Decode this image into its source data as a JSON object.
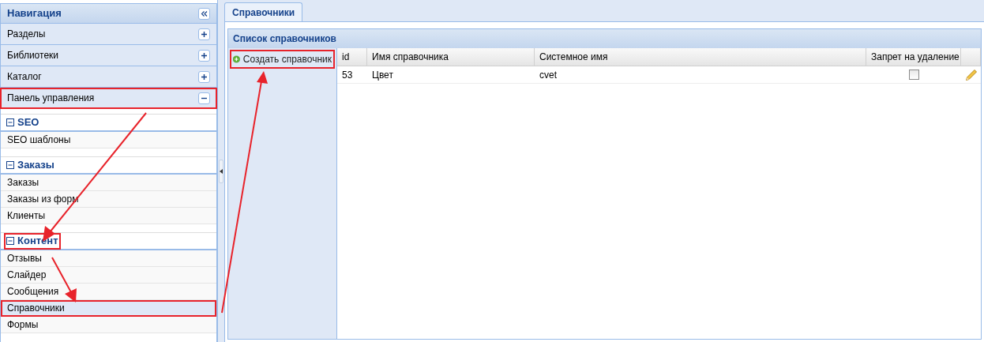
{
  "navigation": {
    "title": "Навигация",
    "sections": [
      {
        "label": "Разделы",
        "expanded": false,
        "highlighted": false
      },
      {
        "label": "Библиотеки",
        "expanded": false,
        "highlighted": false
      },
      {
        "label": "Каталог",
        "expanded": false,
        "highlighted": false
      },
      {
        "label": "Панель управления",
        "expanded": true,
        "highlighted": true
      }
    ],
    "groups": [
      {
        "title": "SEO",
        "expanded": true,
        "highlighted": false,
        "items": [
          {
            "label": "SEO шаблоны",
            "selected": false,
            "highlighted": false
          }
        ]
      },
      {
        "title": "Заказы",
        "expanded": true,
        "highlighted": false,
        "items": [
          {
            "label": "Заказы",
            "selected": false,
            "highlighted": false
          },
          {
            "label": "Заказы из форм",
            "selected": false,
            "highlighted": false
          },
          {
            "label": "Клиенты",
            "selected": false,
            "highlighted": false
          }
        ]
      },
      {
        "title": "Контент",
        "expanded": true,
        "highlighted": true,
        "items": [
          {
            "label": "Отзывы",
            "selected": false,
            "highlighted": false
          },
          {
            "label": "Слайдер",
            "selected": false,
            "highlighted": false
          },
          {
            "label": "Сообщения",
            "selected": false,
            "highlighted": false
          },
          {
            "label": "Справочники",
            "selected": true,
            "highlighted": true
          },
          {
            "label": "Формы",
            "selected": false,
            "highlighted": false
          }
        ]
      }
    ]
  },
  "tabs": [
    {
      "label": "Справочники",
      "selected": true
    }
  ],
  "panel": {
    "title": "Список справочников",
    "create_button": {
      "label": "Создать справочник",
      "highlighted": true
    },
    "table": {
      "columns": [
        "id",
        "Имя справочника",
        "Системное имя",
        "Запрет на удаление"
      ],
      "rows": [
        {
          "cells": [
            "53",
            "Цвет",
            "cvet"
          ],
          "delete_locked": false
        }
      ]
    }
  }
}
